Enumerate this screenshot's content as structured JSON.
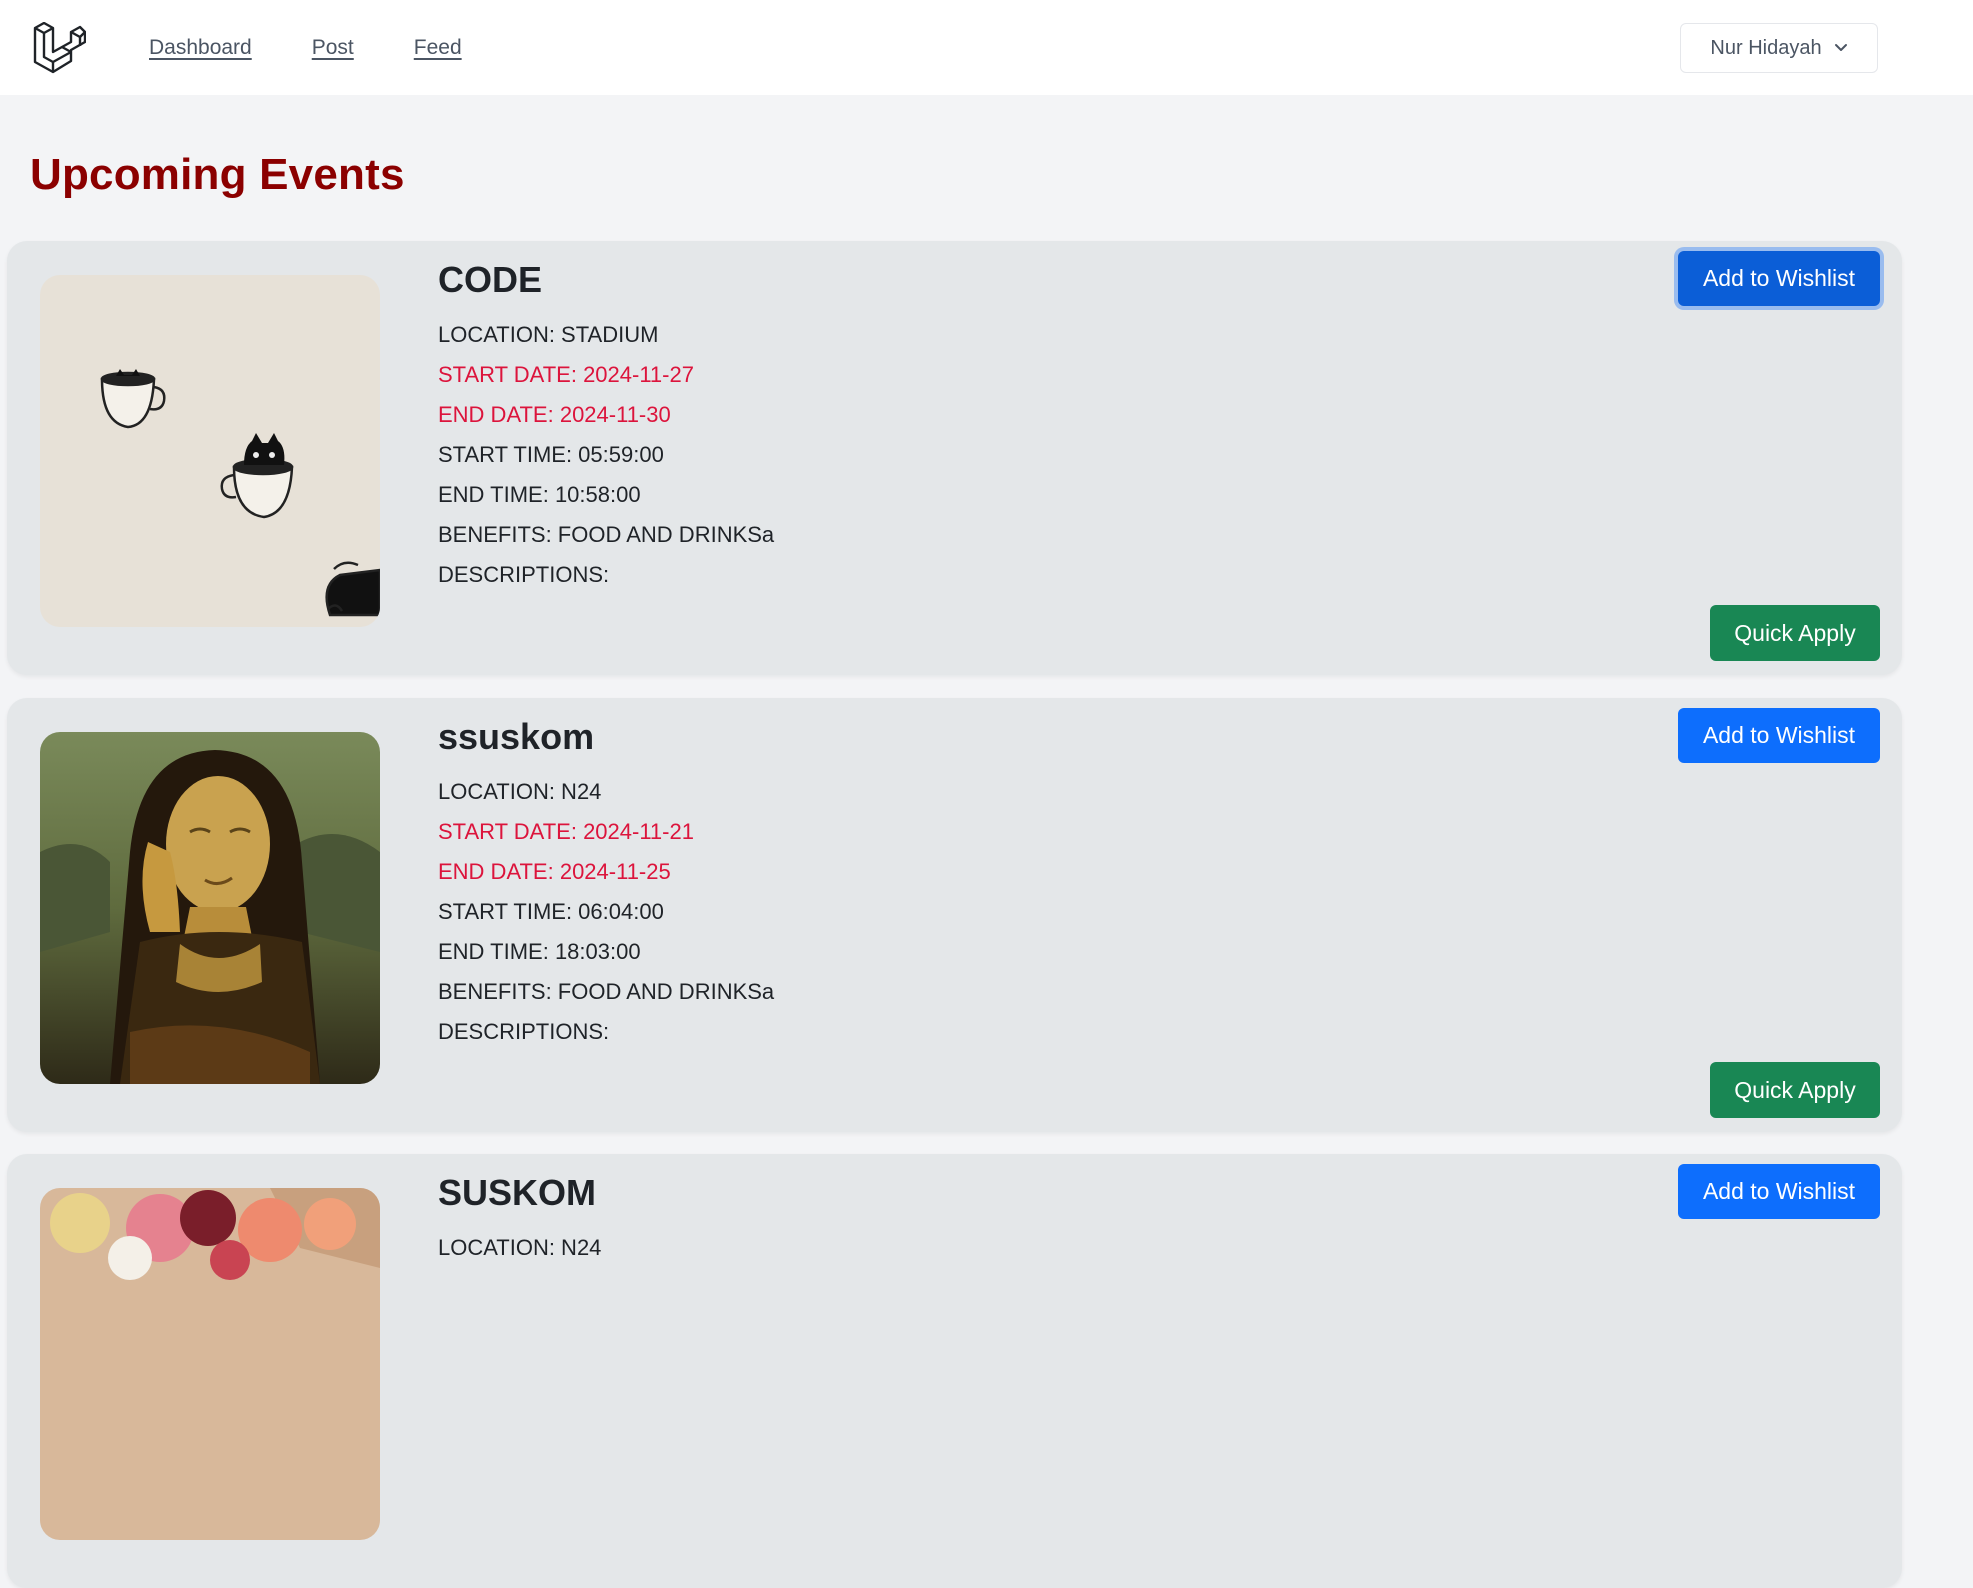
{
  "nav": {
    "links": [
      "Dashboard",
      "Post",
      "Feed"
    ],
    "user_name": "Nur Hidayah",
    "user_menu_icon": "chevron-down-icon",
    "logo_icon": "laravel-logo-icon"
  },
  "page": {
    "title": "Upcoming Events"
  },
  "events": [
    {
      "title": "CODE",
      "location": "LOCATION: STADIUM",
      "start_date": "START DATE: 2024-11-27",
      "end_date": "END DATE: 2024-11-30",
      "start_time": "START TIME: 05:59:00",
      "end_time": "END TIME: 10:58:00",
      "benefits": "BENEFITS: FOOD AND DRINKSa",
      "descriptions": "DESCRIPTIONS:",
      "wishlist_label": "Add to Wishlist",
      "apply_label": "Quick Apply"
    },
    {
      "title": "ssuskom",
      "location": "LOCATION: N24",
      "start_date": "START DATE: 2024-11-21",
      "end_date": "END DATE: 2024-11-25",
      "start_time": "START TIME: 06:04:00",
      "end_time": "END TIME: 18:03:00",
      "benefits": "BENEFITS: FOOD AND DRINKSa",
      "descriptions": "DESCRIPTIONS:",
      "wishlist_label": "Add to Wishlist",
      "apply_label": "Quick Apply"
    },
    {
      "title": "SUSKOM",
      "location": "LOCATION: N24",
      "wishlist_label": "Add to Wishlist"
    }
  ],
  "colors": {
    "title": "#8b0000",
    "date_text": "#dc143c",
    "wishlist_button": "#0d6efd",
    "apply_button": "#198754",
    "card_bg": "#e4e7e9",
    "page_bg": "#f3f4f6"
  }
}
